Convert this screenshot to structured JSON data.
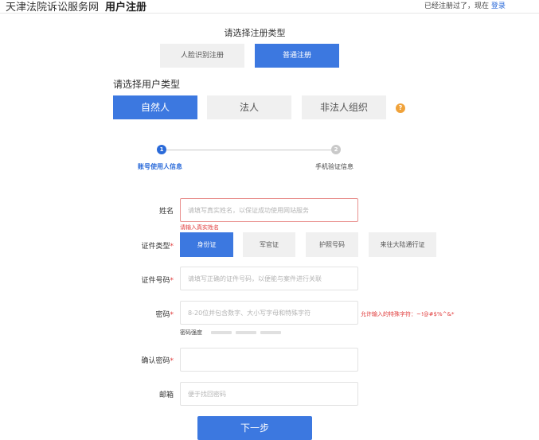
{
  "header": {
    "site_name": "天津法院诉讼服务网",
    "page_title": "用户注册",
    "login_prompt": "已经注册过了，现在",
    "login_link": "登录"
  },
  "registration_type": {
    "title": "请选择注册类型",
    "options": [
      "人脸识别注册",
      "普通注册"
    ],
    "selected": "普通注册"
  },
  "user_type": {
    "title": "请选择用户类型",
    "options": [
      "自然人",
      "法人",
      "非法人组织"
    ],
    "selected": "自然人",
    "help_icon": "?"
  },
  "steps": [
    {
      "number": "1",
      "label": "账号使用人信息",
      "active": true
    },
    {
      "number": "2",
      "label": "手机验证信息",
      "active": false
    }
  ],
  "form": {
    "name": {
      "label": "姓名",
      "placeholder": "请填写真实姓名，以保证成功使用网站服务",
      "value": "",
      "error": "请输入真实姓名"
    },
    "id_type": {
      "label": "证件类型",
      "required_mark": "*",
      "options": [
        "身份证",
        "军官证",
        "护照号码",
        "来往大陆通行证"
      ],
      "selected": "身份证"
    },
    "id_number": {
      "label": "证件号码",
      "required_mark": "*",
      "placeholder": "请填写正确的证件号码，以便能与案件进行关联",
      "value": ""
    },
    "password": {
      "label": "密码",
      "required_mark": "*",
      "placeholder": "8-20位并包含数字、大小写字母和特殊字符",
      "value": "",
      "hint": "允许输入的特殊字符：~!@#$%^&*",
      "strength_label": "密码强度"
    },
    "confirm_password": {
      "label": "确认密码",
      "required_mark": "*",
      "placeholder": "",
      "value": ""
    },
    "email": {
      "label": "邮箱",
      "placeholder": "便于找回密码",
      "value": ""
    }
  },
  "next_button": "下一步",
  "colors": {
    "primary": "#3c78e0",
    "link": "#2a6ad9",
    "error": "#e03c3c",
    "help": "#f0a23a",
    "inactive_button": "#f0f0f0"
  }
}
